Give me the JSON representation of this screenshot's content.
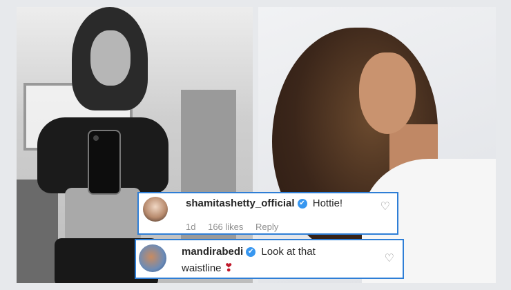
{
  "comments": [
    {
      "username": "shamitashetty_official",
      "verified_icon": "✔",
      "text": "Hottie!",
      "time": "1d",
      "likes": "166 likes",
      "reply": "Reply",
      "like_icon": "♡"
    },
    {
      "username": "mandirabedi",
      "verified_icon": "✔",
      "text_line1": "Look at that",
      "text_line2": "waistline",
      "emoji": "❣",
      "like_icon": "♡"
    }
  ],
  "colors": {
    "highlight_border": "#2e7ed6",
    "verified_badge": "#3897f0",
    "meta_text": "#8e8e8e",
    "heart_emoji": "#c0182a"
  }
}
